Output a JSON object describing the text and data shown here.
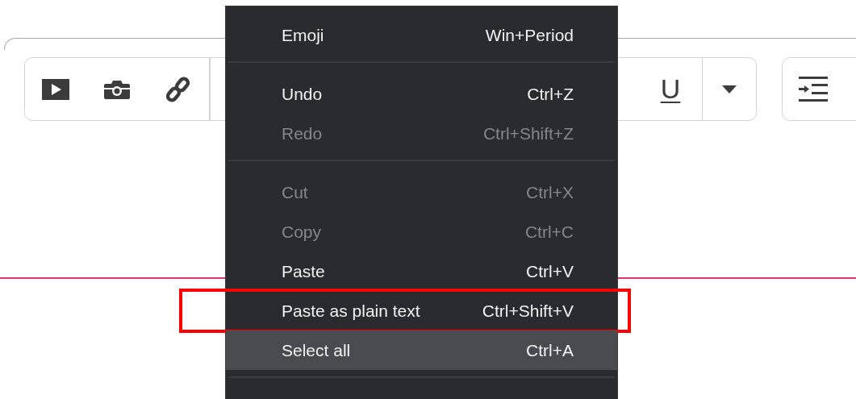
{
  "toolbar": {
    "groups": [
      {
        "buttons": [
          {
            "kind": "video"
          },
          {
            "kind": "camera"
          },
          {
            "kind": "link"
          }
        ]
      },
      {
        "buttons": [
          {
            "kind": "underline",
            "label": "U"
          },
          {
            "kind": "caret"
          }
        ]
      },
      {
        "buttons": [
          {
            "kind": "indent"
          }
        ]
      }
    ]
  },
  "context_menu": {
    "items": [
      {
        "kind": "item",
        "label": "Emoji",
        "shortcut": "Win+Period",
        "disabled": false,
        "selected": false,
        "outlined": false
      },
      {
        "kind": "separator"
      },
      {
        "kind": "item",
        "label": "Undo",
        "shortcut": "Ctrl+Z",
        "disabled": false,
        "selected": false,
        "outlined": false
      },
      {
        "kind": "item",
        "label": "Redo",
        "shortcut": "Ctrl+Shift+Z",
        "disabled": true,
        "selected": false,
        "outlined": false
      },
      {
        "kind": "separator"
      },
      {
        "kind": "item",
        "label": "Cut",
        "shortcut": "Ctrl+X",
        "disabled": true,
        "selected": false,
        "outlined": false
      },
      {
        "kind": "item",
        "label": "Copy",
        "shortcut": "Ctrl+C",
        "disabled": true,
        "selected": false,
        "outlined": false
      },
      {
        "kind": "item",
        "label": "Paste",
        "shortcut": "Ctrl+V",
        "disabled": false,
        "selected": false,
        "outlined": false
      },
      {
        "kind": "item",
        "label": "Paste as plain text",
        "shortcut": "Ctrl+Shift+V",
        "disabled": false,
        "selected": false,
        "outlined": true
      },
      {
        "kind": "item",
        "label": "Select all",
        "shortcut": "Ctrl+A",
        "disabled": false,
        "selected": true,
        "outlined": false
      },
      {
        "kind": "separator"
      }
    ]
  }
}
